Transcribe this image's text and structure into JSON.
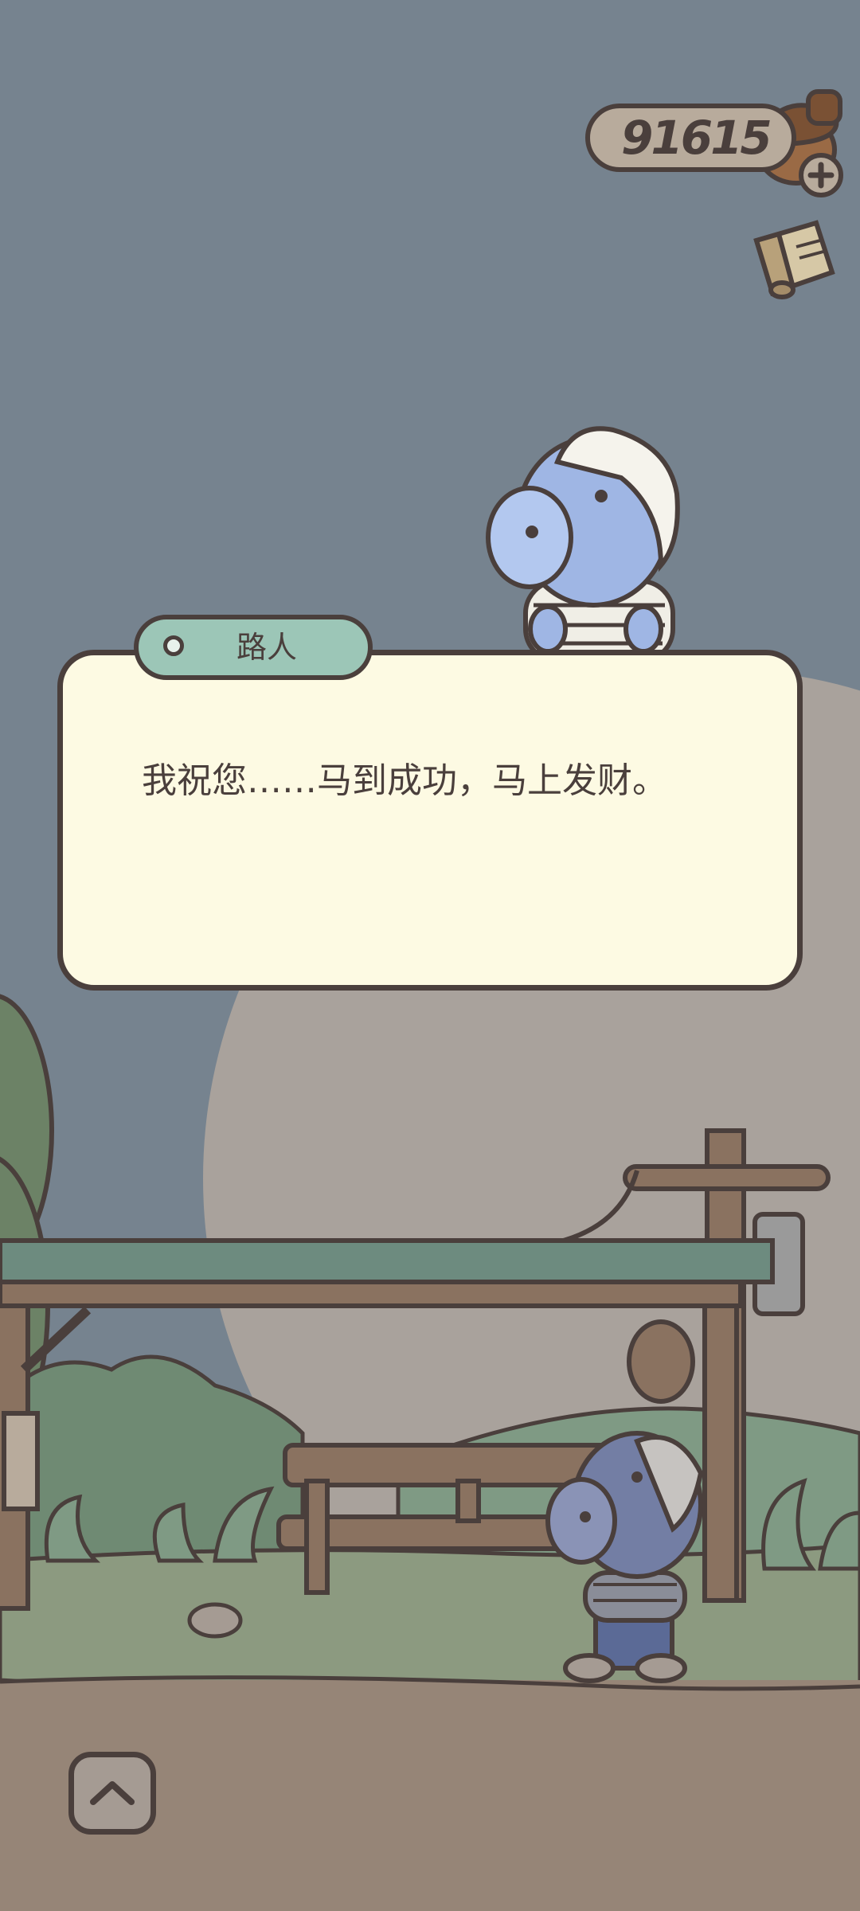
{
  "hud": {
    "coin_count": "91615",
    "coin_icon": "acorn-icon",
    "add_icon": "plus-icon",
    "shop_icon": "ticket-icon"
  },
  "dialog": {
    "speaker": "路人",
    "text": "我祝您……马到成功，马上发财。"
  },
  "controls": {
    "expand_icon": "chevron-up-icon"
  },
  "colors": {
    "sky": "#76838f",
    "moon": "#a9a29c",
    "dialog_bg": "#fdfae3",
    "name_tag": "#9cc6b7",
    "outline": "#4a3f3c"
  }
}
